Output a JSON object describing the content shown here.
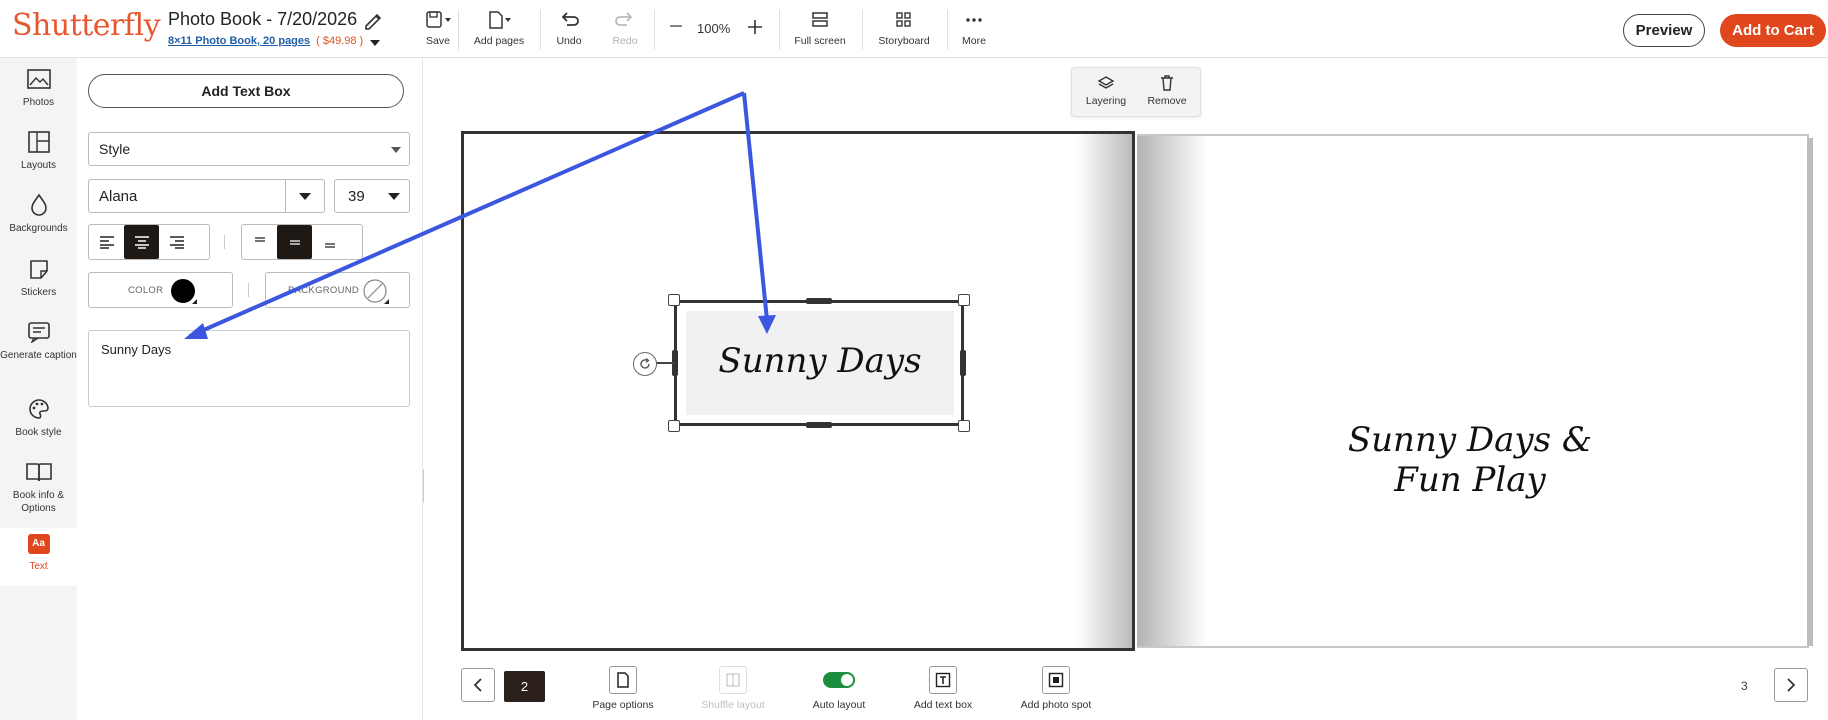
{
  "header": {
    "logo": "Shutterfly",
    "title": "Photo Book - 7/20/2026",
    "product_link": "8×11 Photo Book, 20 pages",
    "price": "( $49.98 )",
    "tools": {
      "save": "Save",
      "add_pages": "Add pages",
      "undo": "Undo",
      "redo": "Redo",
      "zoom": "100%",
      "full_screen": "Full screen",
      "storyboard": "Storyboard",
      "more": "More"
    },
    "preview": "Preview",
    "add_to_cart": "Add to Cart"
  },
  "rail": [
    {
      "label": "Photos",
      "icon": "photos-icon"
    },
    {
      "label": "Layouts",
      "icon": "layouts-icon"
    },
    {
      "label": "Backgrounds",
      "icon": "backgrounds-icon"
    },
    {
      "label": "Stickers",
      "icon": "stickers-icon"
    },
    {
      "label": "Generate caption",
      "icon": "generate-caption-icon"
    },
    {
      "label": "Book style",
      "icon": "palette-icon"
    },
    {
      "label": "Book info & Options",
      "icon": "book-icon"
    },
    {
      "label": "Text",
      "icon": "text-aa-icon",
      "badge": "Aa"
    }
  ],
  "panel": {
    "add_text_box": "Add Text Box",
    "style": "Style",
    "font": "Alana",
    "size": "39",
    "color_label": "COLOR",
    "background_label": "BACKGROUND",
    "text_value": "Sunny Days"
  },
  "canvas": {
    "float_toolbar": {
      "layering": "Layering",
      "remove": "Remove"
    },
    "left_page_text": "Sunny Days",
    "right_page_text_line1": "Sunny Days &",
    "right_page_text_line2": "Fun Play"
  },
  "bottom": {
    "current_page": "2",
    "page_options": "Page options",
    "shuffle_layout": "Shuffle layout",
    "auto_layout": "Auto layout",
    "add_text_box": "Add text box",
    "add_photo_spot": "Add photo spot",
    "right_page_number": "3"
  },
  "colors": {
    "brand": "#e7572f",
    "cart": "#e0471d",
    "annotation_arrow": "#3b57e0",
    "toggle_on": "#1e8e3e"
  }
}
